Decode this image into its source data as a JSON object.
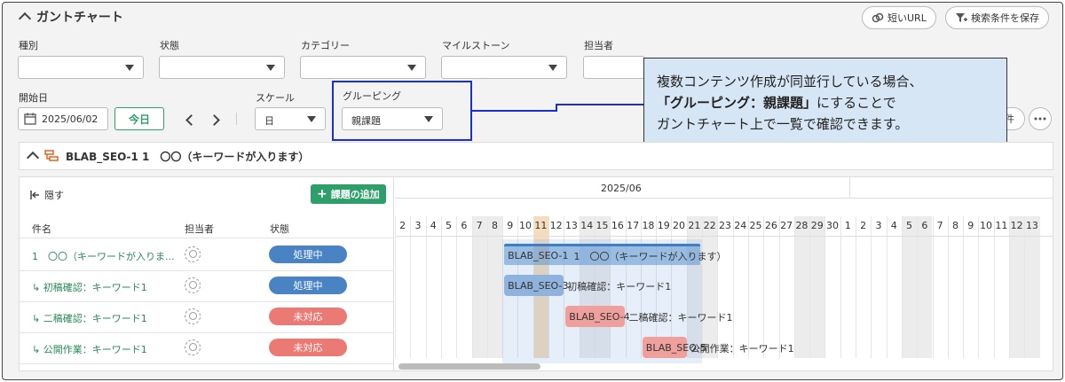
{
  "header": {
    "title": "ガントチャート",
    "short_url": "短いURL",
    "save_search": "検索条件を保存"
  },
  "filters": {
    "type_label": "種別",
    "status_label": "状態",
    "category_label": "カテゴリー",
    "milestone_label": "マイルストーン",
    "assignee_label": "担当者",
    "start_date_label": "開始日",
    "start_date_value": "2025/06/02",
    "today_button": "今日",
    "scale_label": "スケール",
    "scale_value": "日",
    "grouping_label": "グルーピング",
    "grouping_value": "親課題",
    "partial_right": "件"
  },
  "callout": {
    "line1": "複数コンテンツ作成が同並行している場合、",
    "line2_bold": "「グルーピング：親課題」",
    "line2_rest": "にすることで",
    "line3": "ガントチャート上で一覧で確認できます。"
  },
  "section": {
    "title": "BLAB_SEO-1 1　〇〇（キーワードが入ります）"
  },
  "left_panel": {
    "hide_label": "隠す",
    "add_task_button": "課題の追加",
    "columns": {
      "name": "件名",
      "assignee": "担当者",
      "status": "状態"
    },
    "rows": [
      {
        "name": "1　〇〇（キーワードが入りま...",
        "status": "処理中",
        "kind": "proc"
      },
      {
        "name": "↳ 初稿確認：キーワード1",
        "status": "処理中",
        "kind": "proc"
      },
      {
        "name": "↳ 二稿確認：キーワード1",
        "status": "未対応",
        "kind": "todo"
      },
      {
        "name": "↳ 公開作業：キーワード1",
        "status": "未対応",
        "kind": "todo"
      }
    ]
  },
  "gantt": {
    "month_label": "2025/06",
    "days": [
      "2",
      "3",
      "4",
      "5",
      "6",
      "7",
      "8",
      "9",
      "10",
      "11",
      "12",
      "13",
      "14",
      "15",
      "16",
      "17",
      "18",
      "19",
      "20",
      "21",
      "22",
      "23",
      "24",
      "25",
      "26",
      "27",
      "28",
      "29",
      "30",
      "1",
      "2",
      "3",
      "4",
      "5",
      "6",
      "7",
      "8",
      "9",
      "10",
      "11",
      "12",
      "13"
    ],
    "weekend_indices": [
      5,
      6,
      12,
      13,
      19,
      20,
      26,
      27,
      33,
      34,
      40,
      41
    ],
    "today_index": 9,
    "bars": [
      {
        "key": "BLAB_SEO-1",
        "text": "1　〇〇（キーワードが入ります）",
        "start": 7,
        "end": 19,
        "row": 0,
        "color": "#5b93d1",
        "parent": true
      },
      {
        "key": "BLAB_SEO-3",
        "text": "初稿確認：キーワード1",
        "start": 7,
        "end": 10,
        "row": 1,
        "color": "#8fb3dc"
      },
      {
        "key": "BLAB_SEO-4",
        "text": "二稿確認：キーワード1",
        "start": 11,
        "end": 14,
        "row": 2,
        "color": "#f0a09c"
      },
      {
        "key": "BLAB_SEO-5",
        "text": "公開作業：キーワード1",
        "start": 16,
        "end": 18,
        "row": 3,
        "color": "#f0a09c"
      }
    ]
  }
}
